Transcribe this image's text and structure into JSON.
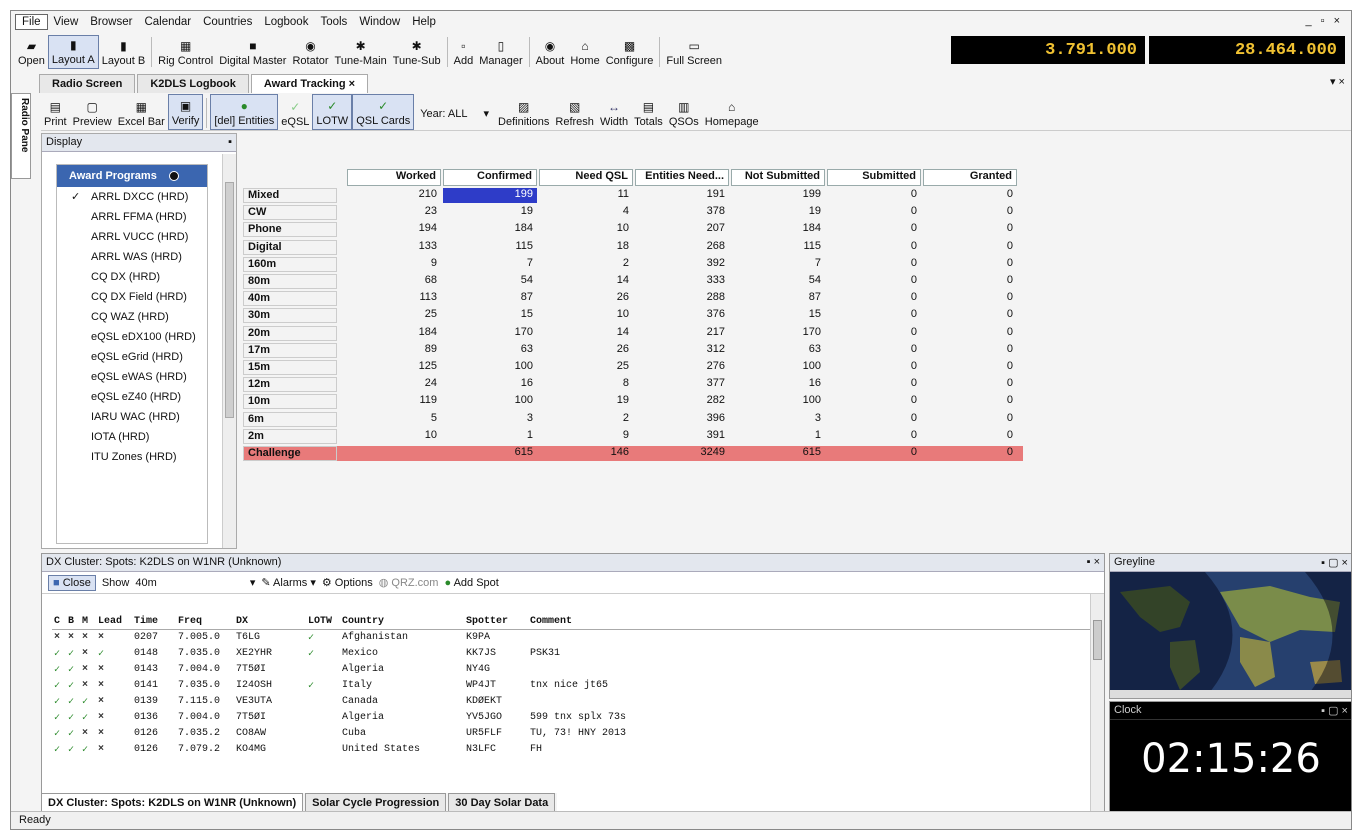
{
  "menu": [
    "File",
    "View",
    "Browser",
    "Calendar",
    "Countries",
    "Logbook",
    "Tools",
    "Window",
    "Help"
  ],
  "window_buttons": "_ ▫ ×",
  "toolbar": [
    {
      "label": "Open",
      "icon": "folder-icon",
      "active": false
    },
    {
      "label": "Layout A",
      "icon": "layout-icon",
      "active": true
    },
    {
      "label": "Layout B",
      "icon": "layout-icon",
      "active": false
    },
    {
      "label": "Rig Control",
      "icon": "radio-icon",
      "active": false
    },
    {
      "label": "Digital Master",
      "icon": "monitor-icon",
      "active": false
    },
    {
      "label": "Rotator",
      "icon": "rotator-icon",
      "active": false
    },
    {
      "label": "Tune-Main",
      "icon": "satellite-icon",
      "active": false
    },
    {
      "label": "Tune-Sub",
      "icon": "satellite-icon",
      "active": false
    },
    {
      "label": "Add",
      "icon": "add-icon",
      "active": false
    },
    {
      "label": "Manager",
      "icon": "manager-icon",
      "active": false
    },
    {
      "label": "About",
      "icon": "info-icon",
      "active": false
    },
    {
      "label": "Home",
      "icon": "home-icon",
      "active": false
    },
    {
      "label": "Configure",
      "icon": "configure-icon",
      "active": false
    },
    {
      "label": "Full Screen",
      "icon": "fullscreen-icon",
      "active": false
    }
  ],
  "freq_a": "3.791.000",
  "freq_b": "28.464.000",
  "doc_tabs": [
    "Radio Screen",
    "K2DLS Logbook",
    "Award Tracking"
  ],
  "doc_tab_close": "×",
  "side_tab": "Radio Pane",
  "award_toolbar": {
    "print": "Print",
    "preview": "Preview",
    "excel": "Excel Bar",
    "verify": "Verify",
    "del_entities": "[del] Entities",
    "eqsl": "eQSL",
    "lotw": "LOTW",
    "qsl_cards": "QSL Cards",
    "year": "Year: ALL",
    "definitions": "Definitions",
    "refresh": "Refresh",
    "width": "Width",
    "totals": "Totals",
    "qsos": "QSOs",
    "homepage": "Homepage"
  },
  "display": {
    "title": "Display",
    "award_programs_title": "Award Programs",
    "items": [
      "ARRL DXCC (HRD)",
      "ARRL FFMA (HRD)",
      "ARRL VUCC (HRD)",
      "ARRL WAS (HRD)",
      "CQ DX (HRD)",
      "CQ DX Field (HRD)",
      "CQ WAZ (HRD)",
      "eQSL eDX100 (HRD)",
      "eQSL eGrid (HRD)",
      "eQSL eWAS (HRD)",
      "eQSL eZ40 (HRD)",
      "IARU WAC (HRD)",
      "IOTA (HRD)",
      "ITU Zones (HRD)"
    ],
    "checked_index": 0
  },
  "grid": {
    "headers": [
      "Worked",
      "Confirmed",
      "Need QSL",
      "Entities Need...",
      "Not Submitted",
      "Submitted",
      "Granted"
    ],
    "rows": [
      {
        "label": "Mixed",
        "values": [
          "210",
          "199",
          "11",
          "191",
          "199",
          "0",
          "0"
        ]
      },
      {
        "label": "CW",
        "values": [
          "23",
          "19",
          "4",
          "378",
          "19",
          "0",
          "0"
        ]
      },
      {
        "label": "Phone",
        "values": [
          "194",
          "184",
          "10",
          "207",
          "184",
          "0",
          "0"
        ]
      },
      {
        "label": "Digital",
        "values": [
          "133",
          "115",
          "18",
          "268",
          "115",
          "0",
          "0"
        ]
      },
      {
        "label": "160m",
        "values": [
          "9",
          "7",
          "2",
          "392",
          "7",
          "0",
          "0"
        ]
      },
      {
        "label": "80m",
        "values": [
          "68",
          "54",
          "14",
          "333",
          "54",
          "0",
          "0"
        ]
      },
      {
        "label": "40m",
        "values": [
          "113",
          "87",
          "26",
          "288",
          "87",
          "0",
          "0"
        ]
      },
      {
        "label": "30m",
        "values": [
          "25",
          "15",
          "10",
          "376",
          "15",
          "0",
          "0"
        ]
      },
      {
        "label": "20m",
        "values": [
          "184",
          "170",
          "14",
          "217",
          "170",
          "0",
          "0"
        ]
      },
      {
        "label": "17m",
        "values": [
          "89",
          "63",
          "26",
          "312",
          "63",
          "0",
          "0"
        ]
      },
      {
        "label": "15m",
        "values": [
          "125",
          "100",
          "25",
          "276",
          "100",
          "0",
          "0"
        ]
      },
      {
        "label": "12m",
        "values": [
          "24",
          "16",
          "8",
          "377",
          "16",
          "0",
          "0"
        ]
      },
      {
        "label": "10m",
        "values": [
          "119",
          "100",
          "19",
          "282",
          "100",
          "0",
          "0"
        ]
      },
      {
        "label": "6m",
        "values": [
          "5",
          "3",
          "2",
          "396",
          "3",
          "0",
          "0"
        ]
      },
      {
        "label": "2m",
        "values": [
          "10",
          "1",
          "9",
          "391",
          "1",
          "0",
          "0"
        ]
      },
      {
        "label": "Challenge",
        "values": [
          "",
          "615",
          "146",
          "3249",
          "615",
          "0",
          "0"
        ]
      }
    ]
  },
  "cluster": {
    "title": "DX Cluster: Spots: K2DLS on W1NR (Unknown)",
    "close": "Close",
    "show": "Show",
    "band": "40m",
    "alarms": "Alarms",
    "options": "Options",
    "qrz": "QRZ.com",
    "add_spot": "Add Spot",
    "columns": [
      "C",
      "B",
      "M",
      "Lead",
      "Time",
      "Freq",
      "DX",
      "LOTW",
      "Country",
      "Spotter",
      "Comment"
    ],
    "rows": [
      {
        "c": "×",
        "b": "×",
        "m": "×",
        "lead": "×",
        "time": "0207",
        "freq": "7.005.0",
        "dx": "T6LG",
        "lotw": "✓",
        "country": "Afghanistan",
        "spotter": "K9PA",
        "comment": ""
      },
      {
        "c": "✓",
        "b": "✓",
        "m": "×",
        "lead": "✓",
        "time": "0148",
        "freq": "7.035.0",
        "dx": "XE2YHR",
        "lotw": "✓",
        "country": "Mexico",
        "spotter": "KK7JS",
        "comment": "PSK31"
      },
      {
        "c": "✓",
        "b": "✓",
        "m": "×",
        "lead": "×",
        "time": "0143",
        "freq": "7.004.0",
        "dx": "7T5ØI",
        "lotw": "",
        "country": "Algeria",
        "spotter": "NY4G",
        "comment": ""
      },
      {
        "c": "✓",
        "b": "✓",
        "m": "×",
        "lead": "×",
        "time": "0141",
        "freq": "7.035.0",
        "dx": "I24OSH",
        "lotw": "✓",
        "country": "Italy",
        "spotter": "WP4JT",
        "comment": "tnx nice jt65"
      },
      {
        "c": "✓",
        "b": "✓",
        "m": "✓",
        "lead": "×",
        "time": "0139",
        "freq": "7.115.0",
        "dx": "VE3UTA",
        "lotw": "",
        "country": "Canada",
        "spotter": "KDØEKT",
        "comment": ""
      },
      {
        "c": "✓",
        "b": "✓",
        "m": "✓",
        "lead": "×",
        "time": "0136",
        "freq": "7.004.0",
        "dx": "7T5ØI",
        "lotw": "",
        "country": "Algeria",
        "spotter": "YV5JGO",
        "comment": "599 tnx splx 73s"
      },
      {
        "c": "✓",
        "b": "✓",
        "m": "×",
        "lead": "×",
        "time": "0126",
        "freq": "7.035.2",
        "dx": "CO8AW",
        "lotw": "",
        "country": "Cuba",
        "spotter": "UR5FLF",
        "comment": "TU, 73! HNY 2013"
      },
      {
        "c": "✓",
        "b": "✓",
        "m": "✓",
        "lead": "×",
        "time": "0126",
        "freq": "7.079.2",
        "dx": "KO4MG",
        "lotw": "",
        "country": "United States",
        "spotter": "N3LFC",
        "comment": "FH"
      }
    ]
  },
  "bottom_tabs": [
    "DX Cluster: Spots: K2DLS on W1NR (Unknown)",
    "Solar Cycle Progression",
    "30 Day Solar Data"
  ],
  "greyline_title": "Greyline",
  "clock_title": "Clock",
  "clock_time": "02:15:26",
  "status": "Ready",
  "colors": {
    "highlight": "#2e3cc8",
    "challenge": "#e87a7a",
    "freq_text": "#f1c232"
  }
}
